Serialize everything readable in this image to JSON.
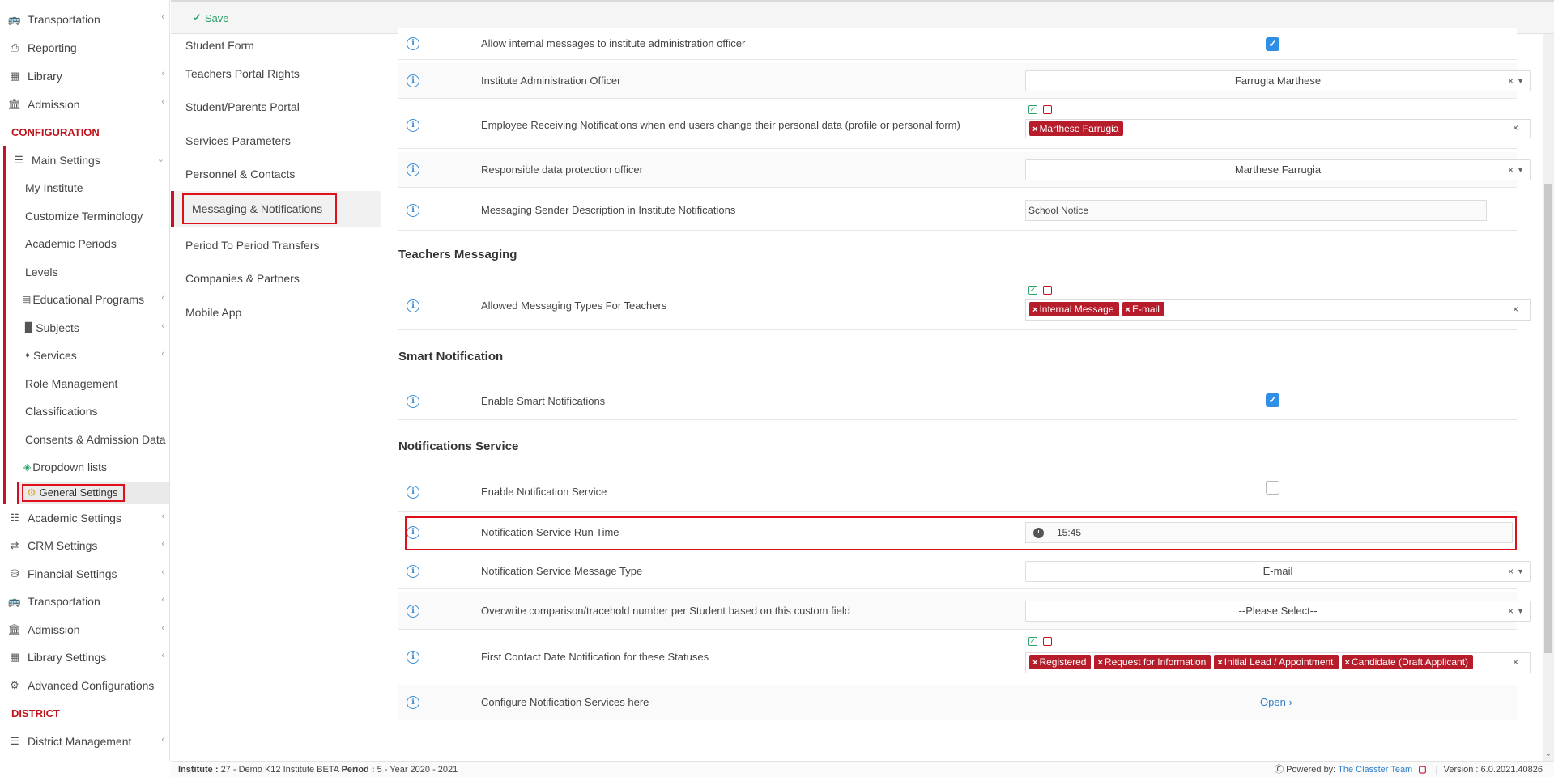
{
  "sidebar": {
    "items": [
      {
        "label": "Transportation",
        "icon": "bus-icon",
        "chevron": true
      },
      {
        "label": "Reporting",
        "icon": "printer-icon",
        "chevron": false
      },
      {
        "label": "Library",
        "icon": "library-icon",
        "chevron": true
      },
      {
        "label": "Admission",
        "icon": "institution-icon",
        "chevron": true
      }
    ],
    "configuration_label": "CONFIGURATION",
    "main_settings": {
      "label": "Main Settings",
      "icon": "sliders-icon"
    },
    "sub_items": [
      {
        "label": "My Institute"
      },
      {
        "label": "Customize Terminology"
      },
      {
        "label": "Academic Periods"
      },
      {
        "label": "Levels"
      },
      {
        "label": "Educational Programs",
        "icon": "table-icon",
        "chevron": true
      },
      {
        "label": "Subjects",
        "icon": "book-icon",
        "chevron": true
      },
      {
        "label": "Services",
        "icon": "services-icon",
        "chevron": true
      },
      {
        "label": "Role Management"
      },
      {
        "label": "Classifications"
      },
      {
        "label": "Consents & Admission Data"
      },
      {
        "label": "Dropdown lists",
        "icon": "layers-icon"
      }
    ],
    "general_settings": {
      "label": "General Settings",
      "icon": "gear-icon"
    },
    "after_items": [
      {
        "label": "Academic Settings",
        "icon": "sitemap-icon",
        "chevron": true
      },
      {
        "label": "CRM Settings",
        "icon": "shuffle-icon",
        "chevron": true
      },
      {
        "label": "Financial Settings",
        "icon": "coins-icon",
        "chevron": true
      },
      {
        "label": "Transportation",
        "icon": "bus-icon",
        "chevron": true
      },
      {
        "label": "Admission",
        "icon": "institution-icon",
        "chevron": true
      },
      {
        "label": "Library Settings",
        "icon": "library-icon",
        "chevron": true
      },
      {
        "label": "Advanced Configurations",
        "icon": "gears-icon",
        "chevron": false
      }
    ],
    "district_label": "DISTRICT",
    "district_item": {
      "label": "District Management",
      "icon": "list-icon",
      "chevron": true
    }
  },
  "toolbar": {
    "save_label": "Save"
  },
  "submenu": {
    "items": [
      {
        "label": "Student Form"
      },
      {
        "label": "Teachers Portal Rights"
      },
      {
        "label": "Student/Parents Portal"
      },
      {
        "label": "Services Parameters"
      },
      {
        "label": "Personnel & Contacts"
      },
      {
        "label": "Messaging & Notifications",
        "active": true
      },
      {
        "label": "Period To Period Transfers"
      },
      {
        "label": "Companies & Partners"
      },
      {
        "label": "Mobile App"
      }
    ]
  },
  "main": {
    "rows_top": [
      {
        "label": "Allow internal messages to institute administration officer",
        "checked": true
      },
      {
        "label": "Institute Administration Officer",
        "select": "Farrugia Marthese"
      },
      {
        "label": "Employee Receiving Notifications when end users change their personal data (profile or personal form)",
        "tags": [
          "Marthese Farrugia"
        ]
      },
      {
        "label": "Responsible data protection officer",
        "select": "Marthese Farrugia"
      },
      {
        "label": "Messaging Sender Description in Institute Notifications",
        "text": "School Notice"
      }
    ],
    "teachers_section": "Teachers Messaging",
    "teachers_row": {
      "label": "Allowed Messaging Types For Teachers",
      "tags": [
        "Internal Message",
        "E-mail"
      ]
    },
    "smart_section": "Smart Notification",
    "smart_row": {
      "label": "Enable Smart Notifications",
      "checked": true
    },
    "notif_section": "Notifications Service",
    "notif_rows": {
      "enable": {
        "label": "Enable Notification Service",
        "checked": false
      },
      "run_time": {
        "label": "Notification Service Run Time",
        "value": "15:45"
      },
      "message_type": {
        "label": "Notification Service Message Type",
        "select": "E-mail"
      },
      "overwrite": {
        "label": "Overwrite comparison/tracehold number per Student based on this custom field",
        "select": "--Please Select--"
      },
      "first_contact": {
        "label": "First Contact Date Notification for these Statuses",
        "tags": [
          "Registered",
          "Request for Information",
          "Initial Lead / Appointment",
          "Candidate (Draft Applicant)"
        ]
      },
      "configure": {
        "label": "Configure Notification Services here",
        "link": "Open"
      }
    }
  },
  "footer": {
    "institute_label": "Institute :",
    "institute_value": "27 - Demo K12 Institute BETA",
    "period_label": "Period :",
    "period_value": "5 - Year 2020 - 2021",
    "powered_by": "Powered by:",
    "powered_link": "The Classter Team",
    "version": "Version : 6.0.2021.40826"
  }
}
